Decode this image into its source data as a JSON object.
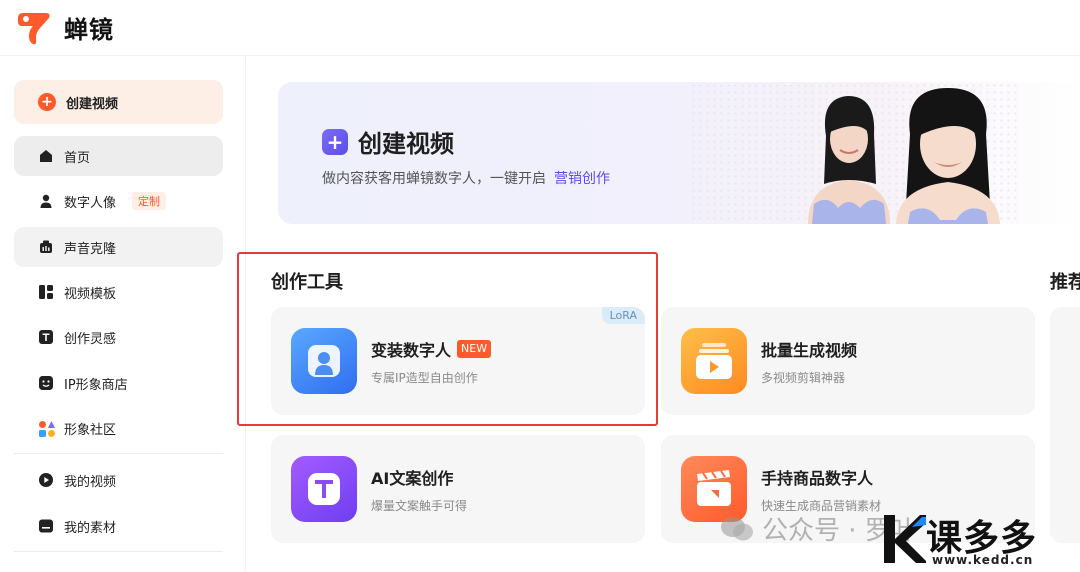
{
  "brand": {
    "name": "蝉镜",
    "color": "#ff5a2c"
  },
  "sidebar": {
    "create_label": "创建视频",
    "items": [
      {
        "label": "首页",
        "icon": "home-icon"
      },
      {
        "label": "数字人像",
        "icon": "person-icon",
        "badge": "定制"
      },
      {
        "label": "声音克隆",
        "icon": "microphone-icon"
      },
      {
        "label": "视频模板",
        "icon": "template-icon"
      },
      {
        "label": "创作灵感",
        "icon": "text-t-icon"
      },
      {
        "label": "IP形象商店",
        "icon": "face-icon"
      },
      {
        "label": "形象社区",
        "icon": "community-icon"
      },
      {
        "label": "我的视频",
        "icon": "play-circle-icon"
      },
      {
        "label": "我的素材",
        "icon": "folder-icon"
      }
    ]
  },
  "banner": {
    "title": "创建视频",
    "subtitle": "做内容获客用蝉镜数字人，一键开启",
    "subtitle_link": "营销创作"
  },
  "tools": {
    "section_title": "创作工具",
    "recommend_title": "推荐",
    "cards": [
      {
        "name": "变装数字人",
        "desc": "专属IP造型自由创作",
        "badge": "NEW",
        "tag": "LoRA",
        "icon": "person-card-icon"
      },
      {
        "name": "批量生成视频",
        "desc": "多视频剪辑神器",
        "icon": "video-stack-icon"
      },
      {
        "name": "AI文案创作",
        "desc": "爆量文案触手可得",
        "icon": "text-t-icon"
      },
      {
        "name": "手持商品数字人",
        "desc": "快速生成商品营销素材",
        "icon": "clapper-icon"
      }
    ]
  },
  "watermark": {
    "wechat_text": "公众号 · 罗叶",
    "site_name": "课多多",
    "site_url": "www.kedd.cn"
  }
}
